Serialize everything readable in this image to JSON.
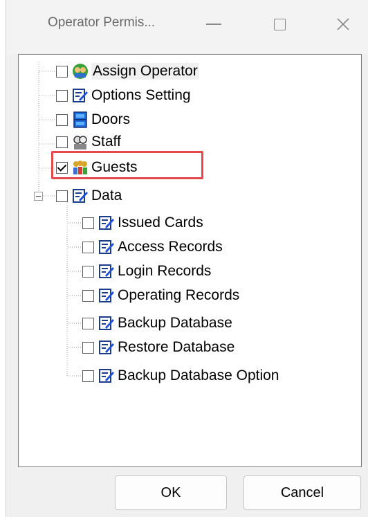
{
  "window": {
    "title": "Operator Permis...",
    "controls": {
      "minimize": "minimize-icon",
      "maximize": "maximize-icon",
      "close": "close-icon"
    }
  },
  "tree": {
    "items": [
      {
        "label": "Assign Operator",
        "checked": false,
        "icon": "people-icon",
        "level": 0
      },
      {
        "label": "Options Setting",
        "checked": false,
        "icon": "edit-icon",
        "level": 0
      },
      {
        "label": "Doors",
        "checked": false,
        "icon": "door-icon",
        "level": 0
      },
      {
        "label": "Staff",
        "checked": false,
        "icon": "staff-icon",
        "level": 0
      },
      {
        "label": "Guests",
        "checked": true,
        "icon": "guests-icon",
        "level": 0
      },
      {
        "label": "Data",
        "checked": false,
        "icon": "edit-icon",
        "level": 0,
        "expanded": true
      },
      {
        "label": "Issued Cards",
        "checked": false,
        "icon": "edit-icon",
        "level": 1
      },
      {
        "label": "Access Records",
        "checked": false,
        "icon": "edit-icon",
        "level": 1
      },
      {
        "label": "Login Records",
        "checked": false,
        "icon": "edit-icon",
        "level": 1
      },
      {
        "label": "Operating Records",
        "checked": false,
        "icon": "edit-icon",
        "level": 1
      },
      {
        "label": "Backup Database",
        "checked": false,
        "icon": "edit-icon",
        "level": 1
      },
      {
        "label": "Restore Database",
        "checked": false,
        "icon": "edit-icon",
        "level": 1
      },
      {
        "label": "Backup Database Option",
        "checked": false,
        "icon": "edit-icon",
        "level": 1
      }
    ]
  },
  "buttons": {
    "ok": "OK",
    "cancel": "Cancel"
  },
  "colors": {
    "highlight_box": "#e5484d",
    "window_bg": "#f0f0f0"
  }
}
